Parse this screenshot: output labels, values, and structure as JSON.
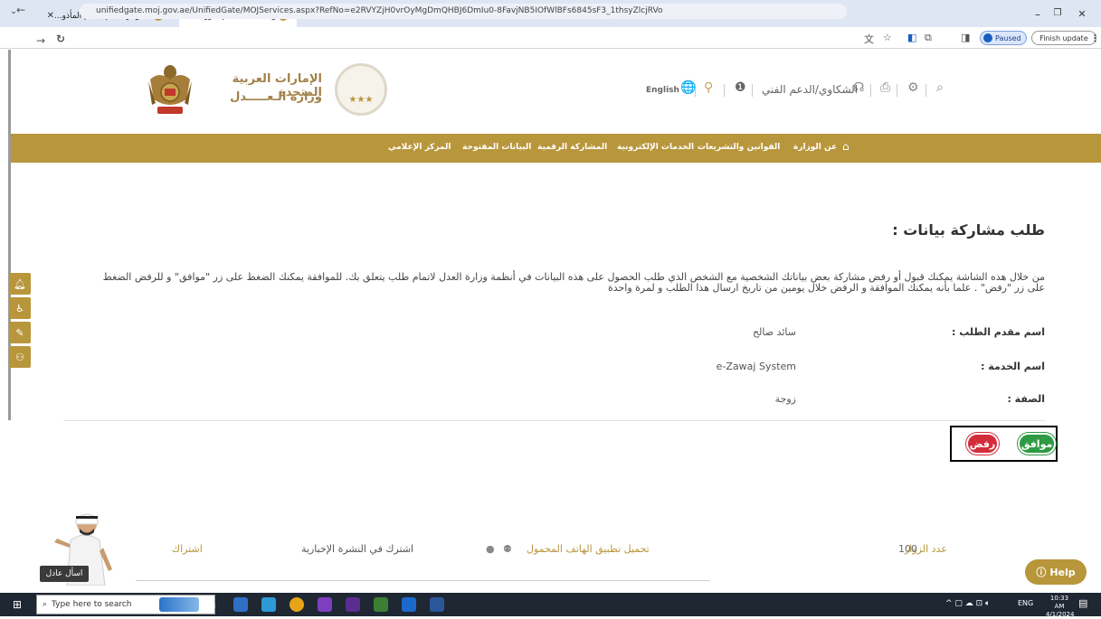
{
  "browser": {
    "tabs": [
      {
        "title": "بوابة الخدمات الإلكترونية الموحّ...",
        "active": true
      },
      {
        "title": "أهلاً وسهلاً بكم بنظام المأذو...",
        "active": false
      }
    ],
    "new_tab": "+",
    "url": "unifiedgate.moj.gov.ae/UnifiedGate/MOJServices.aspx?RefNo=e2RVYZjH0vrOyMgDmQHBJ6DmIu0-8FavjNB5IOfWlBFs6845sF3_1thsyZlcjRVo",
    "paused_label": "Paused",
    "finish_update_label": "Finish update"
  },
  "header": {
    "title_line1": "الإمارات العربية المتحدة",
    "title_line2": "وزارة الـعـــــدل",
    "seal_stars": "★★★",
    "english_label": "English",
    "support_label": "الشكاوي/الدعم الفني"
  },
  "nav": {
    "items": [
      "عن الوزارة",
      "القوانين والتشريعات",
      "الخدمات الإلكترونية",
      "المشاركة الرقمية",
      "البيانات المفتوحة",
      "المركز الإعلامي"
    ]
  },
  "main": {
    "title": "طلب مشاركة بيانات :",
    "description_line1": "من خلال هذه الشاشة يمكنك قبول أو رفض مشاركة بعض بياناتك الشخصية مع الشخص الذي طلب الحصول على هذه البيانات في أنظمة وزارة العدل لاتمام طلب يتعلق بك. للموافقة يمكنك الضغط على زر \"موافق\" و للرفض الضغط",
    "description_line2": "على زر \"رفض\" . علما بأنه يمكنك الموافقة و الرفض خلال يومين من تاريخ ارسال هذا الطلب و لمرة واحدة",
    "fields": [
      {
        "label": "اسم مقدم الطلب :",
        "value": "سائد صالح"
      },
      {
        "label": "اسم الخدمة :",
        "value": "e-Zawaj System"
      },
      {
        "label": "الصفة :",
        "value": "زوجة"
      }
    ],
    "accept_label": "موافق",
    "reject_label": "رفض"
  },
  "footer": {
    "visitors_label": "عدد الزوار",
    "visitors_count": "100",
    "app_label": "تحميل تطبيق الهاتف المحمول",
    "newsletter_label": "اشترك في النشرة الإخبارية",
    "subscribe_label": "اشتراك",
    "ask_label": "اسأل عادل",
    "help_label": "Help"
  },
  "taskbar": {
    "search_placeholder": "Type here to search",
    "lang": "ENG",
    "time": "10:33 AM",
    "date": "4/1/2024"
  },
  "colors": {
    "brand_gold": "#b8963c",
    "accept_green": "#2e9a44",
    "reject_red": "#d32d3b"
  }
}
